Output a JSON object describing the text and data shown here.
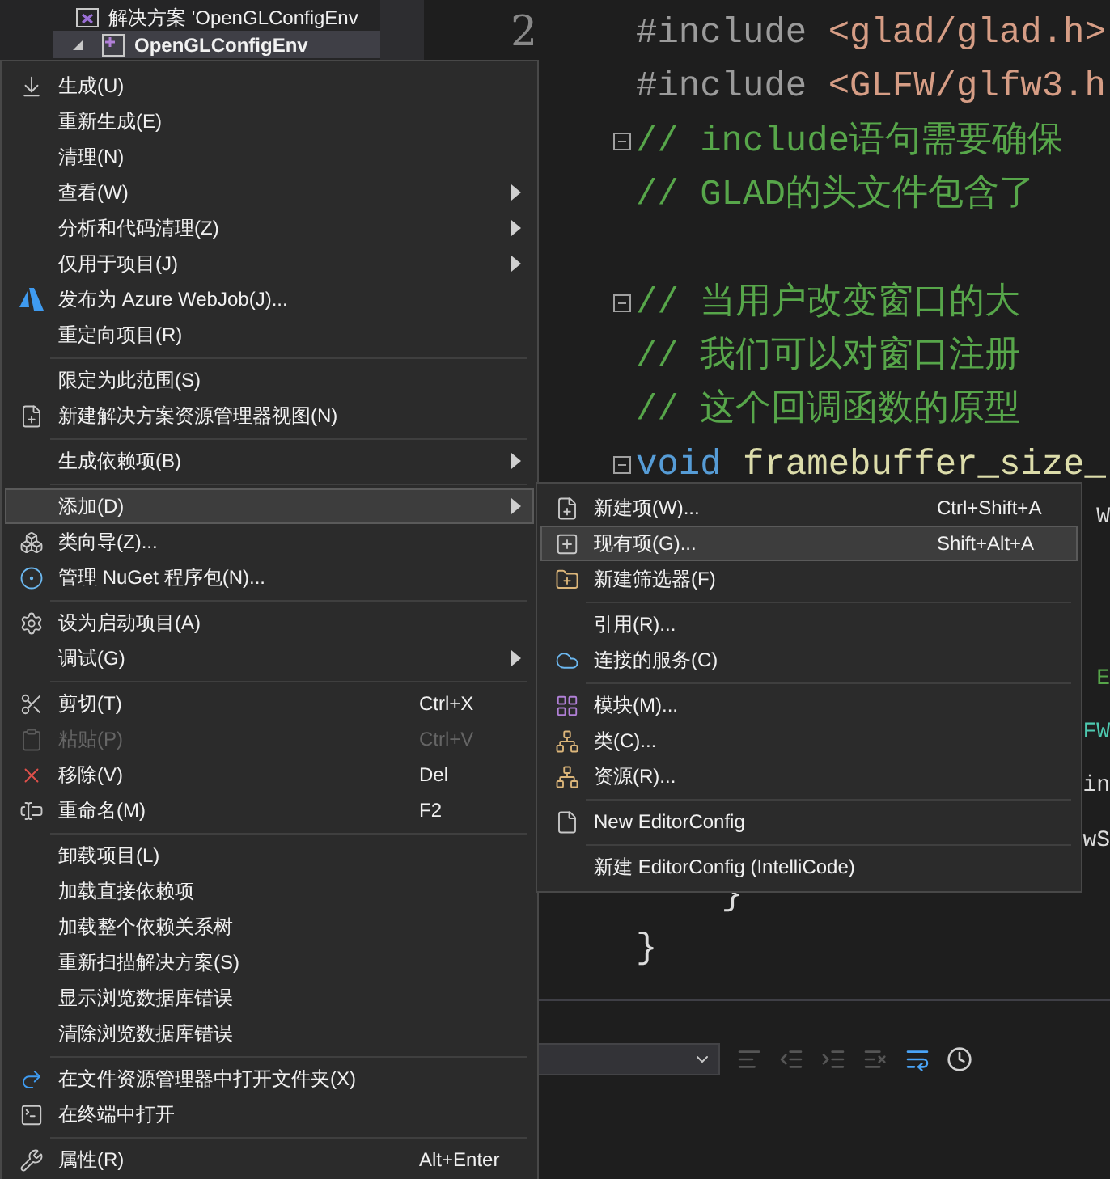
{
  "solution_explorer": {
    "rows": [
      {
        "text": "解决方案 'OpenGLConfigEnv",
        "selected": false
      },
      {
        "text": "OpenGLConfigEnv",
        "selected": true
      }
    ]
  },
  "editor": {
    "line_number": "2",
    "lines": [
      {
        "kind": "code",
        "collapsible": false,
        "segments": [
          {
            "kind": "directive",
            "text": "#include "
          },
          {
            "kind": "include",
            "text": "<glad/glad.h>"
          }
        ]
      },
      {
        "kind": "code",
        "collapsible": false,
        "segments": [
          {
            "kind": "directive",
            "text": "#include "
          },
          {
            "kind": "include",
            "text": "<GLFW/glfw3.h"
          }
        ]
      },
      {
        "kind": "code",
        "collapsible": true,
        "segments": [
          {
            "kind": "comment",
            "text": "// include语句需要确保"
          }
        ]
      },
      {
        "kind": "code",
        "collapsible": false,
        "segments": [
          {
            "kind": "comment",
            "text": "// GLAD的头文件包含了"
          }
        ]
      },
      {
        "kind": "code",
        "collapsible": false
      },
      {
        "kind": "code",
        "collapsible": true,
        "segments": [
          {
            "kind": "comment",
            "text": "// 当用户改变窗口的大"
          }
        ]
      },
      {
        "kind": "code",
        "collapsible": false,
        "segments": [
          {
            "kind": "comment",
            "text": "// 我们可以对窗口注册"
          }
        ]
      },
      {
        "kind": "code",
        "collapsible": false,
        "segments": [
          {
            "kind": "comment",
            "text": "// 这个回调函数的原型"
          }
        ]
      },
      {
        "kind": "code",
        "collapsible": true,
        "segments": [
          {
            "kind": "keyword",
            "text": "void "
          },
          {
            "kind": "function",
            "text": "framebuffer_size_"
          }
        ]
      },
      {
        "kind": "fragment",
        "segments": [
          {
            "kind": "plain",
            "text": "W"
          }
        ]
      },
      {
        "kind": "fragment"
      },
      {
        "kind": "fragment"
      },
      {
        "kind": "fragment",
        "segments": [
          {
            "kind": "comment",
            "text": "E"
          }
        ]
      },
      {
        "kind": "fragment",
        "segments": [
          {
            "kind": "type",
            "text": "FW"
          }
        ]
      },
      {
        "kind": "fragment",
        "segments": [
          {
            "kind": "plain",
            "text": "in"
          }
        ]
      },
      {
        "kind": "fragment",
        "segments": [
          {
            "kind": "plain",
            "text": "wS"
          }
        ]
      },
      {
        "kind": "code",
        "collapsible": false,
        "segments": [
          {
            "kind": "plain",
            "text": "    }"
          }
        ]
      },
      {
        "kind": "code",
        "collapsible": false,
        "segments": [
          {
            "kind": "plain",
            "text": "}"
          }
        ]
      }
    ]
  },
  "context_menu": {
    "items": [
      {
        "kind": "item",
        "label": "生成(U)",
        "submenu": false,
        "disabled": false,
        "highlighted": false
      },
      {
        "kind": "item",
        "label": "重新生成(E)",
        "submenu": false,
        "disabled": false,
        "highlighted": false
      },
      {
        "kind": "item",
        "label": "清理(N)",
        "submenu": false,
        "disabled": false,
        "highlighted": false
      },
      {
        "kind": "item",
        "label": "查看(W)",
        "submenu": true,
        "disabled": false,
        "highlighted": false
      },
      {
        "kind": "item",
        "label": "分析和代码清理(Z)",
        "submenu": true,
        "disabled": false,
        "highlighted": false
      },
      {
        "kind": "item",
        "label": "仅用于项目(J)",
        "submenu": true,
        "disabled": false,
        "highlighted": false
      },
      {
        "kind": "item",
        "label": "发布为 Azure WebJob(J)...",
        "submenu": false,
        "disabled": false,
        "highlighted": false
      },
      {
        "kind": "item",
        "label": "重定向项目(R)",
        "submenu": false,
        "disabled": false,
        "highlighted": false
      },
      {
        "kind": "separator"
      },
      {
        "kind": "item",
        "label": "限定为此范围(S)",
        "submenu": false,
        "disabled": false,
        "highlighted": false
      },
      {
        "kind": "item",
        "label": "新建解决方案资源管理器视图(N)",
        "submenu": false,
        "disabled": false,
        "highlighted": false
      },
      {
        "kind": "separator"
      },
      {
        "kind": "item",
        "label": "生成依赖项(B)",
        "submenu": true,
        "disabled": false,
        "highlighted": false
      },
      {
        "kind": "separator"
      },
      {
        "kind": "item",
        "label": "添加(D)",
        "submenu": true,
        "disabled": false,
        "highlighted": true
      },
      {
        "kind": "item",
        "label": "类向导(Z)...",
        "submenu": false,
        "disabled": false,
        "highlighted": false
      },
      {
        "kind": "item",
        "label": "管理 NuGet 程序包(N)...",
        "submenu": false,
        "disabled": false,
        "highlighted": false
      },
      {
        "kind": "separator"
      },
      {
        "kind": "item",
        "label": "设为启动项目(A)",
        "submenu": false,
        "disabled": false,
        "highlighted": false
      },
      {
        "kind": "item",
        "label": "调试(G)",
        "submenu": true,
        "disabled": false,
        "highlighted": false
      },
      {
        "kind": "separator"
      },
      {
        "kind": "item",
        "label": "剪切(T)",
        "shortcut": "Ctrl+X",
        "submenu": false,
        "disabled": false,
        "highlighted": false
      },
      {
        "kind": "item",
        "label": "粘贴(P)",
        "shortcut": "Ctrl+V",
        "submenu": false,
        "disabled": true,
        "highlighted": false
      },
      {
        "kind": "item",
        "label": "移除(V)",
        "shortcut": "Del",
        "submenu": false,
        "disabled": false,
        "highlighted": false
      },
      {
        "kind": "item",
        "label": "重命名(M)",
        "shortcut": "F2",
        "submenu": false,
        "disabled": false,
        "highlighted": false
      },
      {
        "kind": "separator"
      },
      {
        "kind": "item",
        "label": "卸载项目(L)",
        "submenu": false,
        "disabled": false,
        "highlighted": false
      },
      {
        "kind": "item",
        "label": "加载直接依赖项",
        "submenu": false,
        "disabled": false,
        "highlighted": false
      },
      {
        "kind": "item",
        "label": "加载整个依赖关系树",
        "submenu": false,
        "disabled": false,
        "highlighted": false
      },
      {
        "kind": "item",
        "label": "重新扫描解决方案(S)",
        "submenu": false,
        "disabled": false,
        "highlighted": false
      },
      {
        "kind": "item",
        "label": "显示浏览数据库错误",
        "submenu": false,
        "disabled": false,
        "highlighted": false
      },
      {
        "kind": "item",
        "label": "清除浏览数据库错误",
        "submenu": false,
        "disabled": false,
        "highlighted": false
      },
      {
        "kind": "separator"
      },
      {
        "kind": "item",
        "label": "在文件资源管理器中打开文件夹(X)",
        "submenu": false,
        "disabled": false,
        "highlighted": false
      },
      {
        "kind": "item",
        "label": "在终端中打开",
        "submenu": false,
        "disabled": false,
        "highlighted": false
      },
      {
        "kind": "separator"
      },
      {
        "kind": "item",
        "label": "属性(R)",
        "shortcut": "Alt+Enter",
        "submenu": false,
        "disabled": false,
        "highlighted": false
      }
    ]
  },
  "submenu": {
    "items": [
      {
        "kind": "item",
        "label": "新建项(W)...",
        "shortcut": "Ctrl+Shift+A",
        "submenu": false,
        "disabled": false,
        "highlighted": false
      },
      {
        "kind": "item",
        "label": "现有项(G)...",
        "shortcut": "Shift+Alt+A",
        "submenu": false,
        "disabled": false,
        "highlighted": true
      },
      {
        "kind": "item",
        "label": "新建筛选器(F)",
        "submenu": false,
        "disabled": false,
        "highlighted": false
      },
      {
        "kind": "separator"
      },
      {
        "kind": "item",
        "label": "引用(R)...",
        "submenu": false,
        "disabled": false,
        "highlighted": false
      },
      {
        "kind": "item",
        "label": "连接的服务(C)",
        "submenu": false,
        "disabled": false,
        "highlighted": false
      },
      {
        "kind": "separator"
      },
      {
        "kind": "item",
        "label": "模块(M)...",
        "submenu": false,
        "disabled": false,
        "highlighted": false
      },
      {
        "kind": "item",
        "label": "类(C)...",
        "submenu": false,
        "disabled": false,
        "highlighted": false
      },
      {
        "kind": "item",
        "label": "资源(R)...",
        "submenu": false,
        "disabled": false,
        "highlighted": false
      },
      {
        "kind": "separator"
      },
      {
        "kind": "item",
        "label": "New EditorConfig",
        "submenu": false,
        "disabled": false,
        "highlighted": false
      },
      {
        "kind": "separator"
      },
      {
        "kind": "item",
        "label": "新建 EditorConfig (IntelliCode)",
        "submenu": false,
        "disabled": false,
        "highlighted": false
      }
    ]
  }
}
